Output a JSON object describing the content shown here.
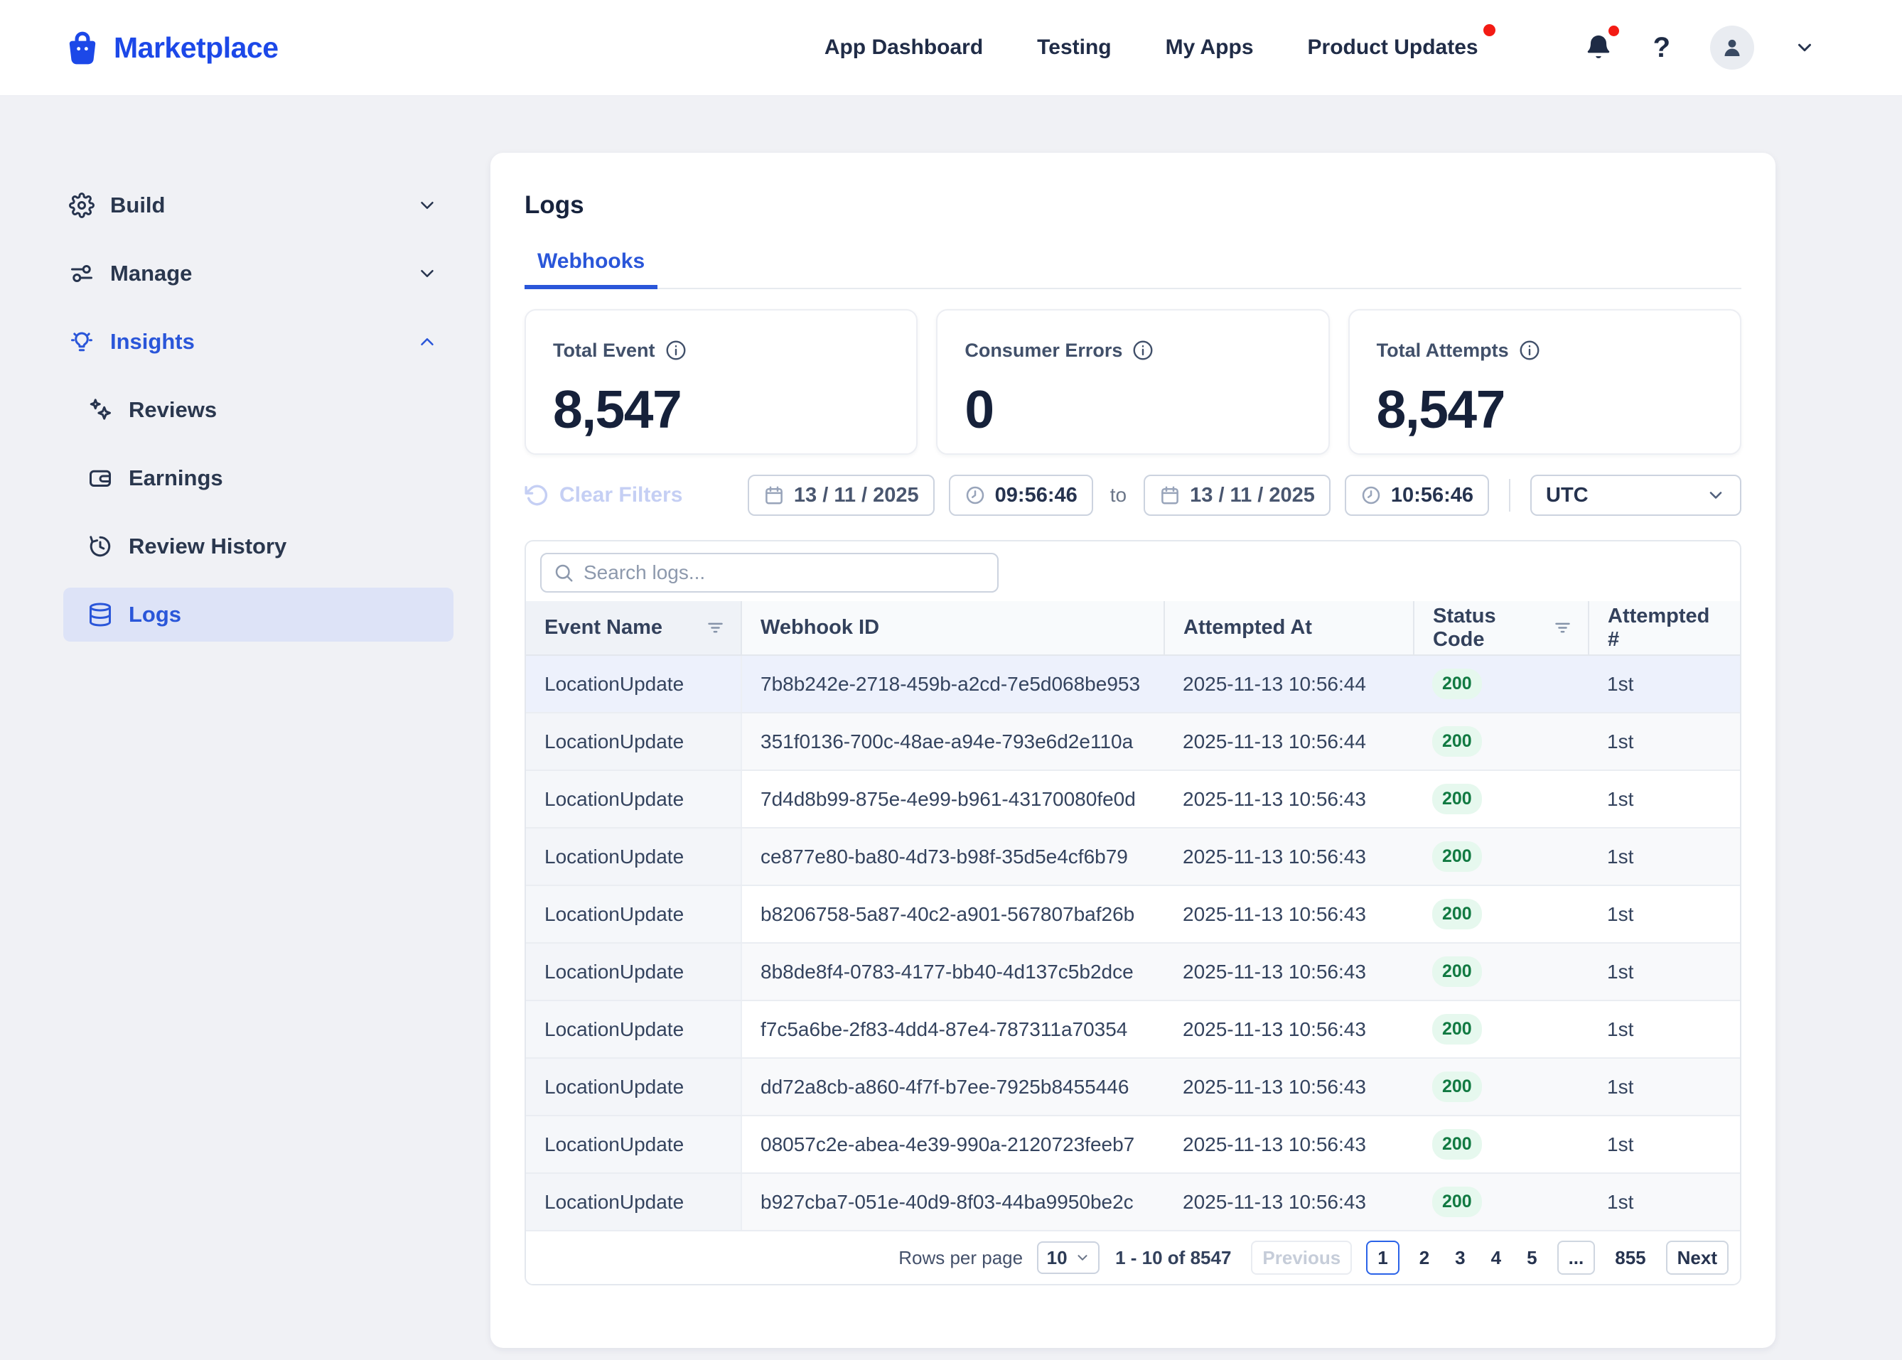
{
  "brand": {
    "name": "Marketplace",
    "icon": "shopping-bag-icon",
    "color": "#1c48e8"
  },
  "topnav": {
    "items": [
      "App Dashboard",
      "Testing",
      "My Apps",
      "Product Updates"
    ],
    "product_updates_has_badge": true,
    "bell_has_badge": true,
    "help_label": "?",
    "badge_color": "#f31b14"
  },
  "sidebar": {
    "items": [
      {
        "label": "Build",
        "icon": "gear-icon",
        "chevron": "down",
        "active": false,
        "sub": false,
        "selected": false
      },
      {
        "label": "Manage",
        "icon": "sliders-icon",
        "chevron": "down",
        "active": false,
        "sub": false,
        "selected": false
      },
      {
        "label": "Insights",
        "icon": "lightbulb-icon",
        "chevron": "up",
        "active": true,
        "sub": false,
        "selected": false
      },
      {
        "label": "Reviews",
        "icon": "sparkles-icon",
        "chevron": null,
        "active": false,
        "sub": true,
        "selected": false
      },
      {
        "label": "Earnings",
        "icon": "wallet-icon",
        "chevron": null,
        "active": false,
        "sub": true,
        "selected": false
      },
      {
        "label": "Review History",
        "icon": "history-icon",
        "chevron": null,
        "active": false,
        "sub": true,
        "selected": false
      },
      {
        "label": "Logs",
        "icon": "database-icon",
        "chevron": null,
        "active": true,
        "sub": true,
        "selected": true
      }
    ],
    "selected_bg": "#dde3f7",
    "active_color": "#2a56d9"
  },
  "page": {
    "title": "Logs",
    "active_tab": "Webhooks"
  },
  "stats": [
    {
      "label": "Total Event",
      "info_icon": "info-icon",
      "value": "8,547"
    },
    {
      "label": "Consumer Errors",
      "info_icon": "info-icon",
      "value": "0"
    },
    {
      "label": "Total Attempts",
      "info_icon": "info-icon",
      "value": "8,547"
    }
  ],
  "filters": {
    "clear_label": "Clear Filters",
    "from_date": "13 / 11 / 2025",
    "from_time": "09:56:46",
    "to_label": "to",
    "to_date": "13 / 11 / 2025",
    "to_time": "10:56:46",
    "timezone": "UTC"
  },
  "search": {
    "placeholder": "Search logs..."
  },
  "table": {
    "columns": [
      "Event Name",
      "Webhook ID",
      "Attempted At",
      "Status Code",
      "Attempted #"
    ],
    "filter_columns": [
      0,
      3
    ],
    "status_colors": {
      "text": "#117a42",
      "bg": "#e6f8ee"
    },
    "rows": [
      {
        "event": "LocationUpdate",
        "webhook_id": "7b8b242e-2718-459b-a2cd-7e5d068be953",
        "attempted_at": "2025-11-13 10:56:44",
        "status": "200",
        "attempt": "1st",
        "highlight": true
      },
      {
        "event": "LocationUpdate",
        "webhook_id": "351f0136-700c-48ae-a94e-793e6d2e110a",
        "attempted_at": "2025-11-13 10:56:44",
        "status": "200",
        "attempt": "1st",
        "highlight": false
      },
      {
        "event": "LocationUpdate",
        "webhook_id": "7d4d8b99-875e-4e99-b961-43170080fe0d",
        "attempted_at": "2025-11-13 10:56:43",
        "status": "200",
        "attempt": "1st",
        "highlight": false
      },
      {
        "event": "LocationUpdate",
        "webhook_id": "ce877e80-ba80-4d73-b98f-35d5e4cf6b79",
        "attempted_at": "2025-11-13 10:56:43",
        "status": "200",
        "attempt": "1st",
        "highlight": false
      },
      {
        "event": "LocationUpdate",
        "webhook_id": "b8206758-5a87-40c2-a901-567807baf26b",
        "attempted_at": "2025-11-13 10:56:43",
        "status": "200",
        "attempt": "1st",
        "highlight": false
      },
      {
        "event": "LocationUpdate",
        "webhook_id": "8b8de8f4-0783-4177-bb40-4d137c5b2dce",
        "attempted_at": "2025-11-13 10:56:43",
        "status": "200",
        "attempt": "1st",
        "highlight": false
      },
      {
        "event": "LocationUpdate",
        "webhook_id": "f7c5a6be-2f83-4dd4-87e4-787311a70354",
        "attempted_at": "2025-11-13 10:56:43",
        "status": "200",
        "attempt": "1st",
        "highlight": false
      },
      {
        "event": "LocationUpdate",
        "webhook_id": "dd72a8cb-a860-4f7f-b7ee-7925b8455446",
        "attempted_at": "2025-11-13 10:56:43",
        "status": "200",
        "attempt": "1st",
        "highlight": false
      },
      {
        "event": "LocationUpdate",
        "webhook_id": "08057c2e-abea-4e39-990a-2120723feeb7",
        "attempted_at": "2025-11-13 10:56:43",
        "status": "200",
        "attempt": "1st",
        "highlight": false
      },
      {
        "event": "LocationUpdate",
        "webhook_id": "b927cba7-051e-40d9-8f03-44ba9950be2c",
        "attempted_at": "2025-11-13 10:56:43",
        "status": "200",
        "attempt": "1st",
        "highlight": false
      }
    ]
  },
  "pagination": {
    "rows_per_page_label": "Rows per page",
    "rows_per_page": "10",
    "range": "1 - 10 of 8547",
    "previous_label": "Previous",
    "pages": [
      "1",
      "2",
      "3",
      "4",
      "5"
    ],
    "current_page": "1",
    "ellipsis": "...",
    "last_page": "855",
    "next_label": "Next"
  }
}
